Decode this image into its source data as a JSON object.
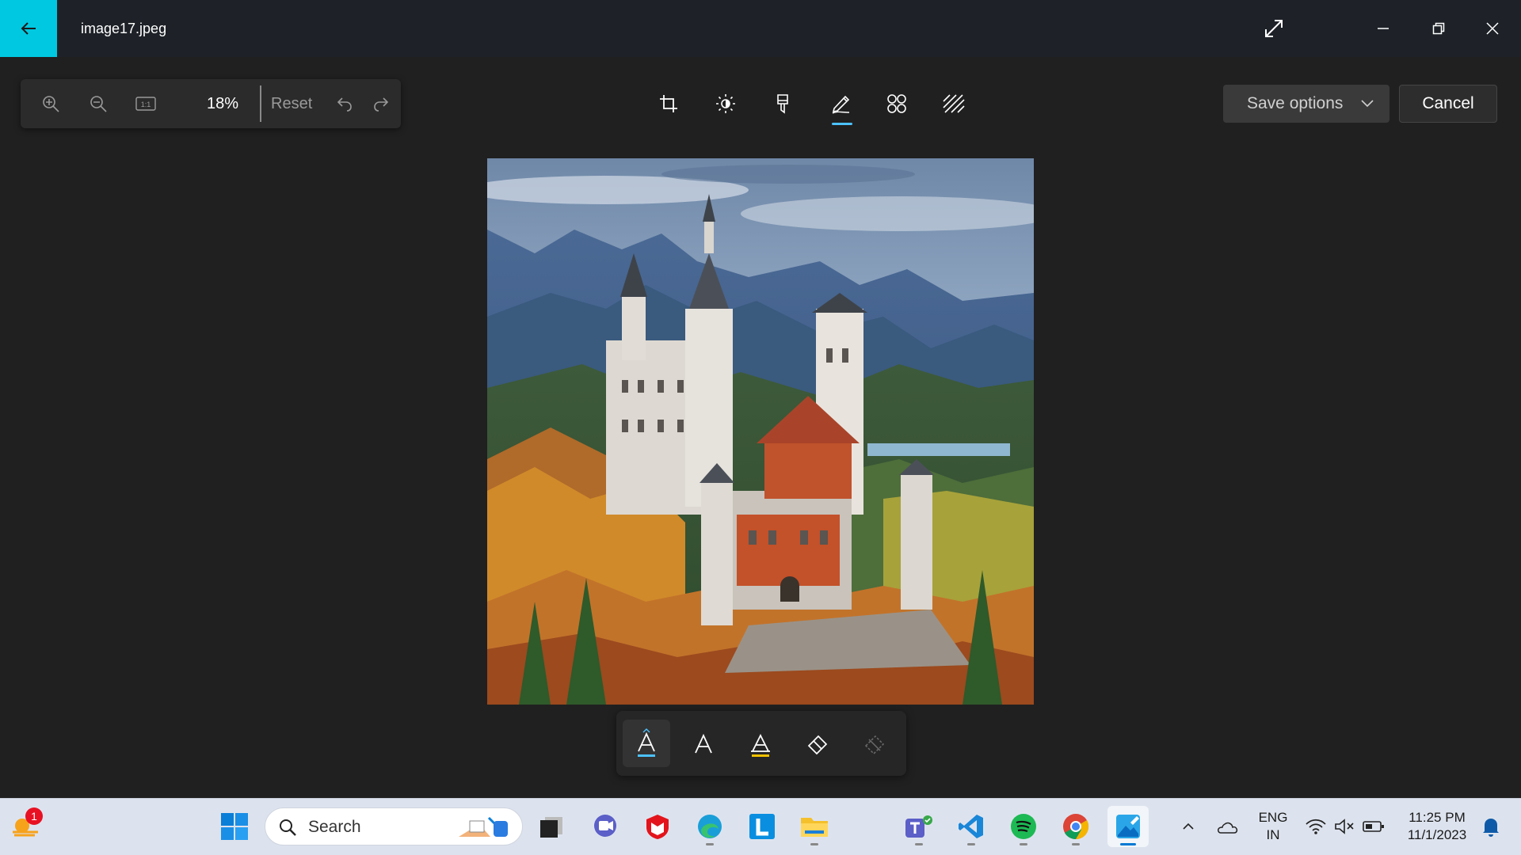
{
  "window": {
    "title": "image17.jpeg"
  },
  "zoom": {
    "value": "18%",
    "reset_label": "Reset"
  },
  "actions": {
    "save_label": "Save options",
    "cancel_label": "Cancel"
  },
  "tools": [
    "crop-icon",
    "adjust-icon",
    "filter-icon",
    "markup-icon",
    "retouch-icon",
    "background-icon"
  ],
  "active_tool": "markup",
  "pens": [
    "ballpoint-pen",
    "pencil",
    "highlighter",
    "eraser",
    "clear-all"
  ],
  "taskbar": {
    "search_label": "Search",
    "weather_badge": "1",
    "language": "ENG",
    "region": "IN",
    "time": "11:25 PM",
    "date": "11/1/2023"
  },
  "colors": {
    "accent": "#00c8e0",
    "active_underline": "#4cc2ff"
  }
}
